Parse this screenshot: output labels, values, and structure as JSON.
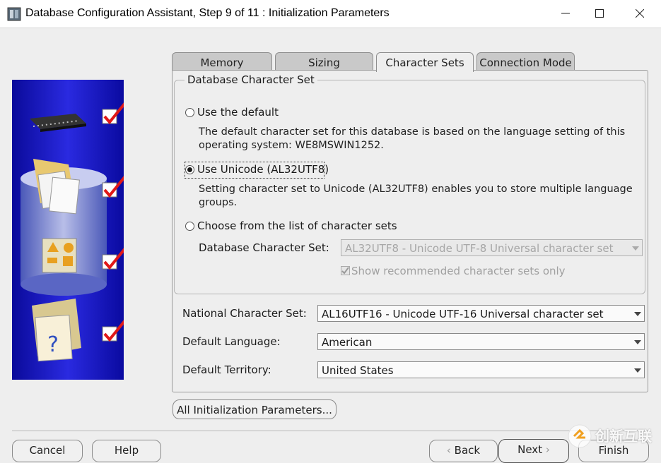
{
  "window": {
    "title": "Database Configuration Assistant, Step 9 of 11 : Initialization Parameters"
  },
  "tabs": [
    {
      "label": "Memory",
      "active": false
    },
    {
      "label": "Sizing",
      "active": false
    },
    {
      "label": "Character Sets",
      "active": true
    },
    {
      "label": "Connection Mode",
      "active": false
    }
  ],
  "charset_group": {
    "title": "Database Character Set",
    "options": [
      {
        "label": "Use the default",
        "selected": false,
        "desc_line1": "The default character set for this database is based on the language setting of this",
        "desc_line2": "operating system: WE8MSWIN1252."
      },
      {
        "label": "Use Unicode (AL32UTF8)",
        "selected": true,
        "desc_line1": "Setting character set to Unicode (AL32UTF8) enables you to store multiple language",
        "desc_line2": "groups."
      },
      {
        "label": "Choose from the list of character sets",
        "selected": false
      }
    ],
    "db_charset_label": "Database Character Set:",
    "db_charset_value": "AL32UTF8 - Unicode UTF-8 Universal character set",
    "show_recommended_label": "Show recommended character sets only",
    "show_recommended_checked": true
  },
  "fields": {
    "national_label": "National Character Set:",
    "national_value": "AL16UTF16 - Unicode UTF-16 Universal character set",
    "language_label": "Default Language:",
    "language_value": "American",
    "territory_label": "Default Territory:",
    "territory_value": "United States"
  },
  "buttons": {
    "all_params": "All Initialization Parameters...",
    "cancel": "Cancel",
    "help": "Help",
    "back": "Back",
    "next": "Next",
    "finish": "Finish"
  },
  "watermark": {
    "text": "创新互联"
  },
  "colors": {
    "side_panel_blue": "#1414c8",
    "check_red": "#e01818"
  }
}
